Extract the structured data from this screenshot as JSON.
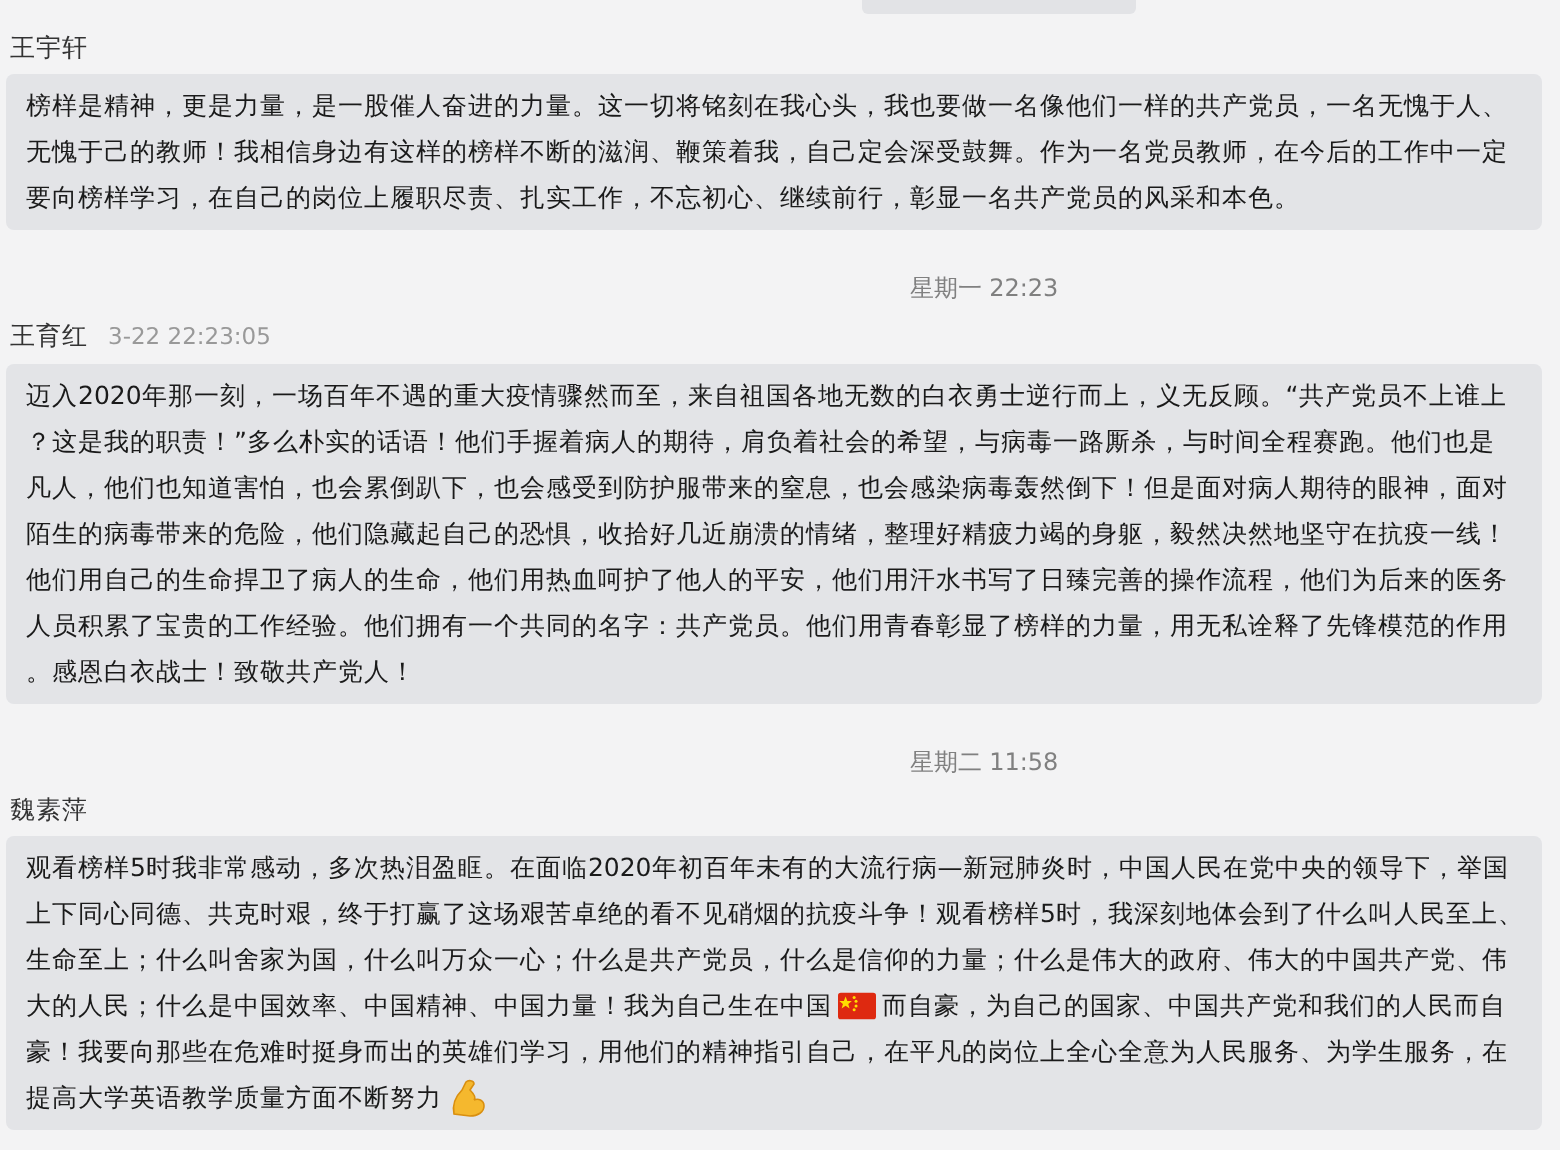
{
  "messages": [
    {
      "kind": "fragment"
    },
    {
      "kind": "message",
      "sender": "王宇轩",
      "lines": [
        {
          "segments": [
            {
              "kind": "text",
              "text": "榜样是精神，更是力量，是一股催人奋进的力量。这一切将铭刻在我心头，我也要做一名像他们一样的共产党员，一名无愧于人、"
            }
          ]
        },
        {
          "segments": [
            {
              "kind": "text",
              "text": "无愧于己的教师！我相信身边有这样的榜样不断的滋润、鞭策着我，自己定会深受鼓舞。作为一名党员教师，在今后的工作中一定"
            }
          ]
        },
        {
          "segments": [
            {
              "kind": "text",
              "text": "要向榜样学习，在自己的岗位上履职尽责、扎实工作，不忘初心、继续前行，彰显一名共产党员的风采和本色。"
            }
          ]
        }
      ]
    },
    {
      "kind": "time",
      "text": "星期一 22:23"
    },
    {
      "kind": "message",
      "sender": "王育红",
      "sent_at": "3-22 22:23:05",
      "lines": [
        {
          "segments": [
            {
              "kind": "text",
              "text": "迈入2020年那一刻，一场百年不遇的重大疫情骤然而至，来自祖国各地无数的白衣勇士逆行而上，义无反顾。“共产党员不上谁上"
            }
          ]
        },
        {
          "segments": [
            {
              "kind": "text",
              "text": "？这是我的职责！”多么朴实的话语！他们手握着病人的期待，肩负着社会的希望，与病毒一路厮杀，与时间全程赛跑。他们也是"
            }
          ]
        },
        {
          "segments": [
            {
              "kind": "text",
              "text": "凡人，他们也知道害怕，也会累倒趴下，也会感受到防护服带来的窒息，也会感染病毒轰然倒下！但是面对病人期待的眼神，面对"
            }
          ]
        },
        {
          "segments": [
            {
              "kind": "text",
              "text": "陌生的病毒带来的危险，他们隐藏起自己的恐惧，收拾好几近崩溃的情绪，整理好精疲力竭的身躯，毅然决然地坚守在抗疫一线！"
            }
          ]
        },
        {
          "segments": [
            {
              "kind": "text",
              "text": "他们用自己的生命捍卫了病人的生命，他们用热血呵护了他人的平安，他们用汗水书写了日臻完善的操作流程，他们为后来的医务"
            }
          ]
        },
        {
          "segments": [
            {
              "kind": "text",
              "text": "人员积累了宝贵的工作经验。他们拥有一个共同的名字：共产党员。他们用青春彰显了榜样的力量，用无私诠释了先锋模范的作用"
            }
          ]
        },
        {
          "segments": [
            {
              "kind": "text",
              "text": "。感恩白衣战士！致敬共产党人！"
            }
          ]
        }
      ]
    },
    {
      "kind": "time",
      "text": "星期二 11:58"
    },
    {
      "kind": "message",
      "sender": "魏素萍",
      "lines": [
        {
          "segments": [
            {
              "kind": "text",
              "text": "观看榜样5时我非常感动，多次热泪盈眶。在面临2020年初百年未有的大流行病—新冠肺炎时，中国人民在党中央的领导下，举国"
            }
          ]
        },
        {
          "segments": [
            {
              "kind": "text",
              "text": "上下同心同德、共克时艰，终于打赢了这场艰苦卓绝的看不见硝烟的抗疫斗争！观看榜样5时，我深刻地体会到了什么叫人民至上、"
            }
          ]
        },
        {
          "segments": [
            {
              "kind": "text",
              "text": "生命至上；什么叫舍家为国，什么叫万众一心；什么是共产党员，什么是信仰的力量；什么是伟大的政府、伟大的中国共产党、伟"
            }
          ]
        },
        {
          "segments": [
            {
              "kind": "text",
              "text": "大的人民；什么是中国效率、中国精神、中国力量！我为自己生在中国"
            },
            {
              "kind": "flag"
            },
            {
              "kind": "text",
              "text": "而自豪，为自己的国家、中国共产党和我们的人民而自"
            }
          ]
        },
        {
          "segments": [
            {
              "kind": "text",
              "text": "豪！我要向那些在危难时挺身而出的英雄们学习，用他们的精神指引自己，在平凡的岗位上全心全意为人民服务、为学生服务，在"
            }
          ]
        },
        {
          "segments": [
            {
              "kind": "text",
              "text": "提高大学英语教学质量方面不断努力"
            },
            {
              "kind": "arm"
            }
          ]
        }
      ]
    }
  ]
}
